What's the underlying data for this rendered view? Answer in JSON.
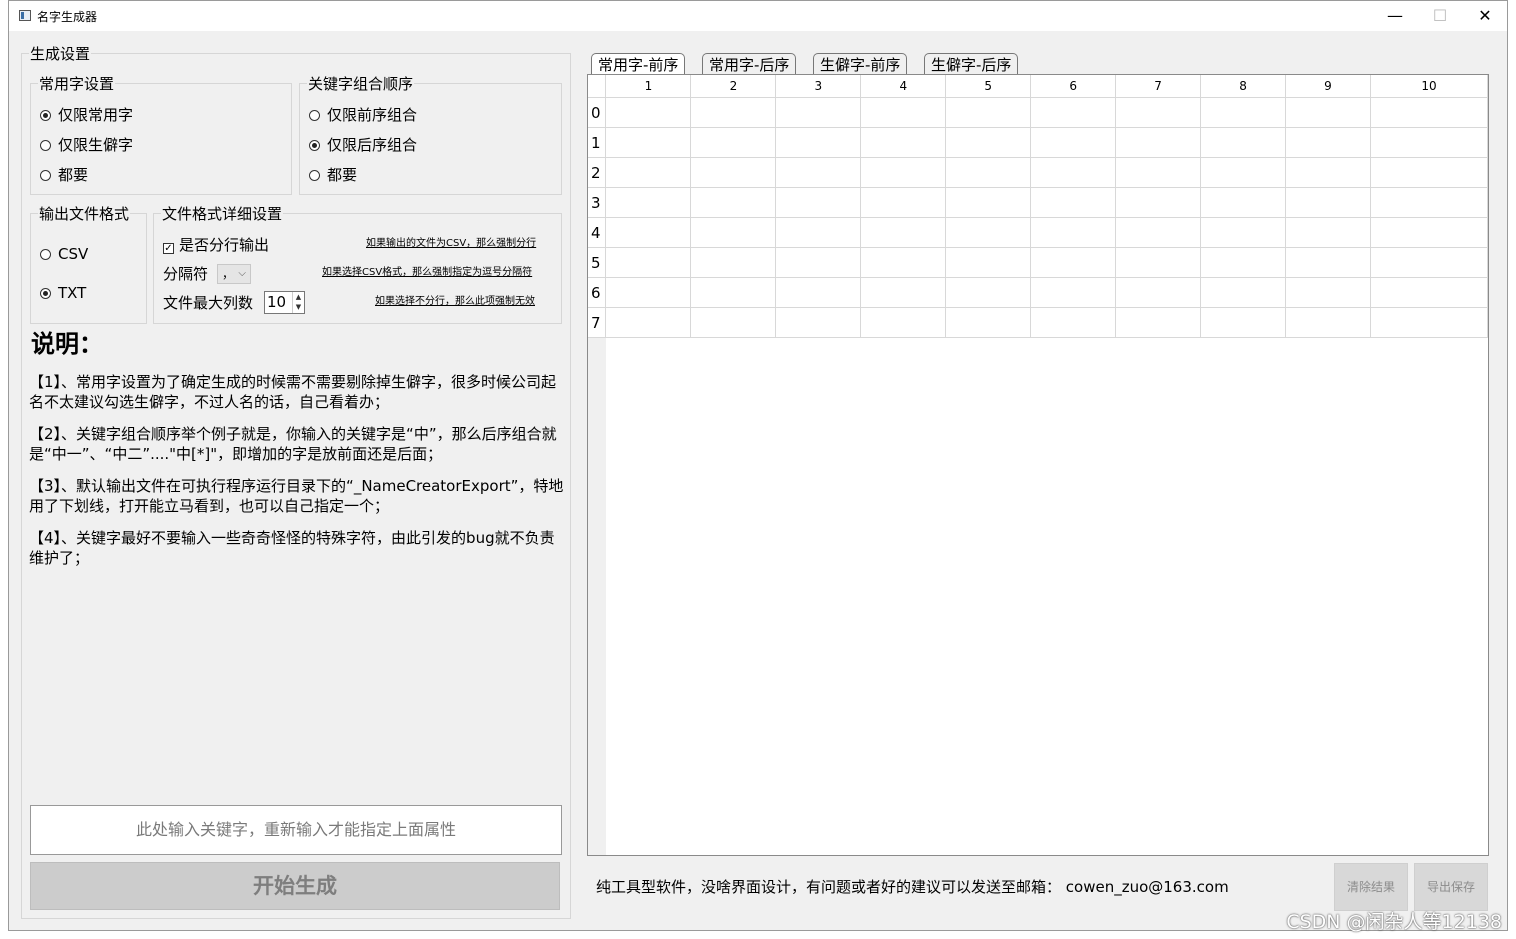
{
  "window": {
    "title": "名字生成器",
    "minimize": "—",
    "maximize": "☐",
    "close": "✕"
  },
  "settings": {
    "group_title": "生成设置",
    "common_chars": {
      "title": "常用字设置",
      "options": [
        "仅限常用字",
        "仅限生僻字",
        "都要"
      ],
      "selected": 0
    },
    "keyword_order": {
      "title": "关键字组合顺序",
      "options": [
        "仅限前序组合",
        "仅限后序组合",
        "都要"
      ],
      "selected": 1
    },
    "output_format": {
      "title": "输出文件格式",
      "options": [
        "CSV",
        "TXT"
      ],
      "selected": 1
    },
    "format_detail": {
      "title": "文件格式详细设置",
      "line_output_label": "是否分行输出",
      "line_output_checked": true,
      "separator_label": "分隔符",
      "separator_value": "，",
      "max_cols_label": "文件最大列数",
      "max_cols_value": "10",
      "hint_line": "如果输出的文件为CSV，那么强制分行",
      "hint_separator": "如果选择CSV格式，那么强制指定为逗号分隔符",
      "hint_max_cols": "如果选择不分行，那么此项强制无效"
    }
  },
  "notes": {
    "title": "说明：",
    "items": [
      "【1】、常用字设置为了确定生成的时候需不需要剔除掉生僻字，很多时候公司起名不太建议勾选生僻字，不过人名的话，自己看着办；",
      "【2】、关键字组合顺序举个例子就是，你输入的关键字是“中”，那么后序组合就是“中一”、“中二”....\"中[*]\"，即增加的字是放前面还是后面；",
      "【3】、默认输出文件在可执行程序运行目录下的“_NameCreatorExport”，特地用了下划线，打开能立马看到，也可以自己指定一个；",
      "【4】、关键字最好不要输入一些奇奇怪怪的特殊字符，由此引发的bug就不负责维护了；"
    ]
  },
  "keyword_input": {
    "placeholder": "此处输入关键字，重新输入才能指定上面属性",
    "value": ""
  },
  "start_button": "开始生成",
  "tabs": [
    "常用字-前序",
    "常用字-后序",
    "生僻字-前序",
    "生僻字-后序"
  ],
  "active_tab": 0,
  "table": {
    "columns": [
      "1",
      "2",
      "3",
      "4",
      "5",
      "6",
      "7",
      "8",
      "9",
      "10"
    ],
    "rows": [
      "0",
      "1",
      "2",
      "3",
      "4",
      "5",
      "6",
      "7"
    ]
  },
  "footer": {
    "message": "纯工具型软件，没啥界面设计，有问题或者好的建议可以发送至邮箱：  cowen_zuo@163.com",
    "clear_button": "清除结果",
    "export_button": "导出保存"
  },
  "watermark": "CSDN @闲杂人等12138"
}
